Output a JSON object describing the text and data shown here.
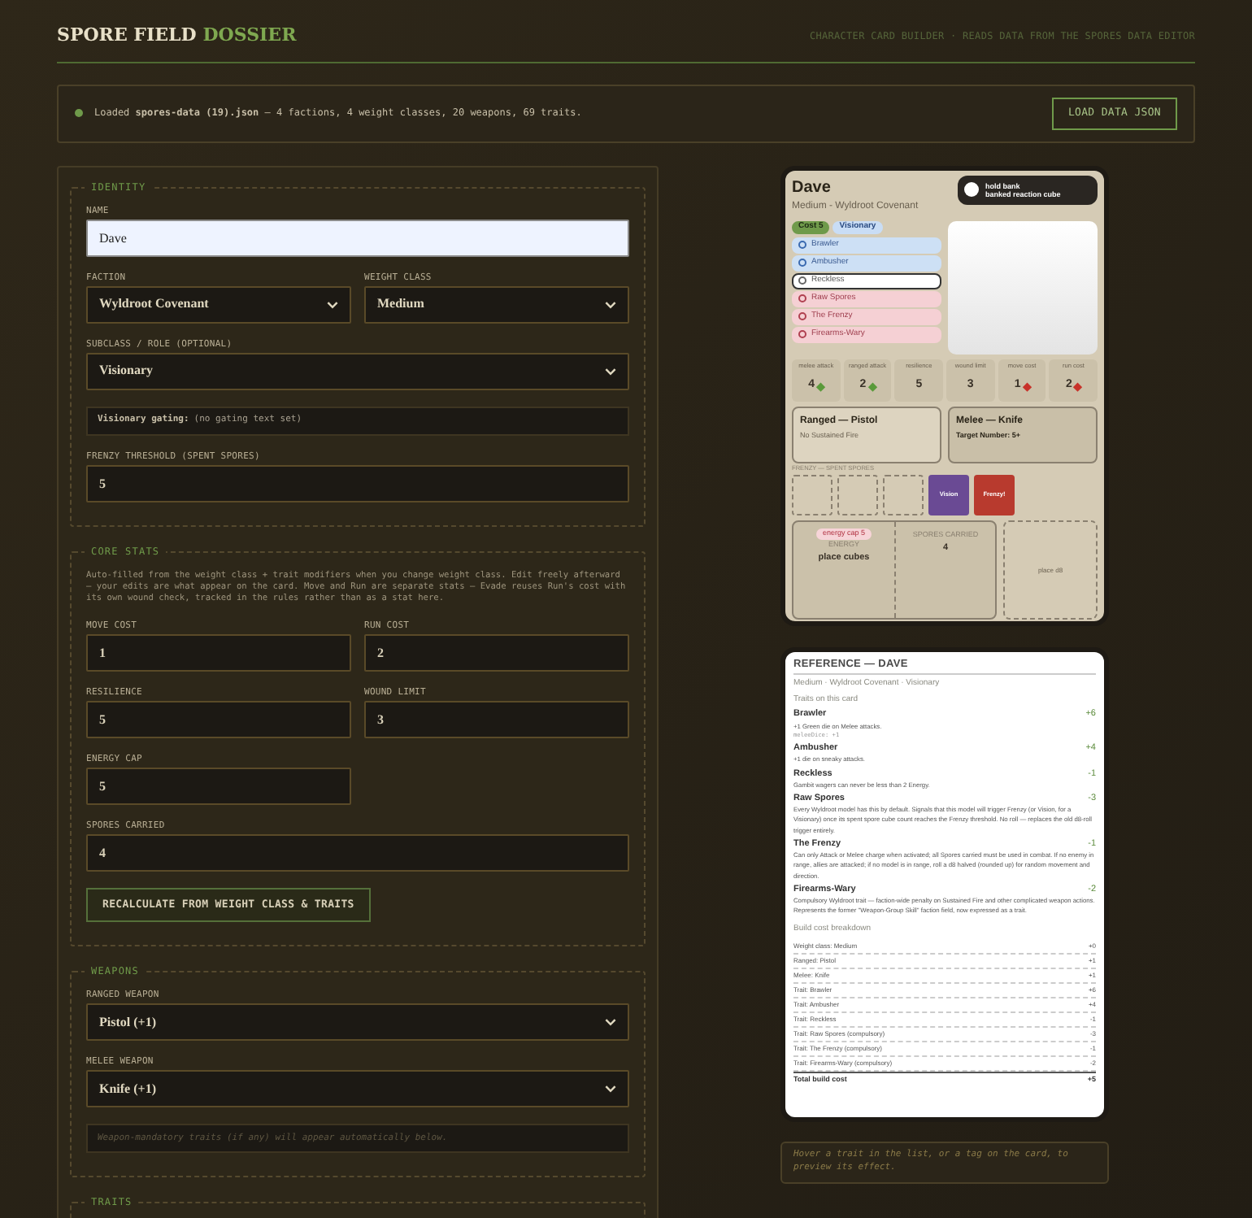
{
  "header": {
    "title": "SPORE FIELD",
    "title_accent": "DOSSIER",
    "tagline": "CHARACTER CARD BUILDER · READS DATA FROM THE SPORES DATA EDITOR"
  },
  "status": {
    "text": "Loaded **spores-data (19).json** — 4 factions, 4 weight classes, 20 weapons, 69 traits.",
    "button": "LOAD DATA JSON"
  },
  "sections": [
    {
      "legend": "IDENTITY",
      "rows": [
        [
          {
            "kind": "text",
            "label": "NAME",
            "value": "Dave"
          }
        ],
        [
          {
            "kind": "select",
            "label": "FACTION",
            "value": "Wyldroot Covenant"
          },
          {
            "kind": "select",
            "label": "WEIGHT CLASS",
            "value": "Medium"
          }
        ],
        [
          {
            "kind": "select",
            "label": "SUBCLASS / ROLE (OPTIONAL)",
            "value": "Visionary"
          }
        ],
        [
          {
            "kind": "note",
            "title": "Visionary gating:",
            "text": "(no gating text set)"
          }
        ],
        [
          {
            "kind": "number_wide",
            "label": "FRENZY THRESHOLD (SPENT SPORES)",
            "value": "5"
          }
        ]
      ]
    },
    {
      "legend": "CORE STATS",
      "rows": [
        [
          {
            "kind": "description",
            "text": "Auto-filled from the weight class + trait modifiers when you change weight class. Edit freely afterward — your edits are what appear on the card. Move and Run are separate stats — Evade reuses Run's cost with its own wound check, tracked in the rules rather than as a stat here."
          }
        ],
        [
          {
            "kind": "number",
            "label": "MOVE COST",
            "value": "1"
          },
          {
            "kind": "number",
            "label": "RUN COST",
            "value": "2"
          }
        ],
        [
          {
            "kind": "number",
            "label": "RESILIENCE",
            "value": "5"
          },
          {
            "kind": "number",
            "label": "WOUND LIMIT",
            "value": "3"
          }
        ],
        [
          {
            "kind": "number",
            "label": "ENERGY CAP",
            "value": "5"
          }
        ],
        [
          {
            "kind": "number_wide",
            "label": "SPORES CARRIED",
            "value": "4"
          }
        ],
        [
          {
            "kind": "button",
            "text": "RECALCULATE FROM WEIGHT CLASS & TRAITS"
          }
        ]
      ]
    },
    {
      "legend": "WEAPONS",
      "rows": [
        [
          {
            "kind": "select",
            "label": "RANGED WEAPON",
            "value": "Pistol (+1)"
          }
        ],
        [
          {
            "kind": "select",
            "label": "MELEE WEAPON",
            "value": "Knife (+1)"
          }
        ],
        [
          {
            "kind": "hint",
            "text": "Weapon-mandatory traits (if any) will appear automatically below."
          }
        ]
      ]
    },
    {
      "legend": "TRAITS"
    }
  ],
  "card": {
    "name": "Dave",
    "subtitle": "Medium - Wyldroot Covenant",
    "bank": {
      "title": "hold bank",
      "subtitle": "banked reaction cube"
    },
    "tags": [
      {
        "text": "Cost 5",
        "color": "#6f9a4a"
      },
      {
        "text": "Visionary",
        "color": "#c9ddf5"
      }
    ],
    "traits": [
      {
        "text": "Brawler",
        "kind": "positive"
      },
      {
        "text": "Ambusher",
        "kind": "positive"
      },
      {
        "text": "Reckless",
        "kind": "neutral"
      },
      {
        "text": "Raw Spores",
        "kind": "negative"
      },
      {
        "text": "The Frenzy",
        "kind": "negative"
      },
      {
        "text": "Firearms-Wary",
        "kind": "negative"
      }
    ],
    "stats": [
      {
        "label": "melee attack",
        "value": "4",
        "color": "#5a9a3a"
      },
      {
        "label": "ranged attack",
        "value": "2",
        "color": "#5a9a3a"
      },
      {
        "label": "resilience",
        "value": "5"
      },
      {
        "label": "wound limit",
        "value": "3"
      },
      {
        "label": "move cost",
        "value": "1",
        "color": "#c8322a"
      },
      {
        "label": "run cost",
        "value": "2",
        "color": "#c8322a"
      }
    ],
    "weapons": [
      {
        "title": "Ranged — Pistol",
        "detail": "No Sustained Fire"
      },
      {
        "title": "Melee — Knife",
        "detail": "Target Number: 5+"
      }
    ],
    "frenzy_label": "FRENZY — SPENT SPORES",
    "slots": [
      {
        "kind": "empty"
      },
      {
        "kind": "empty"
      },
      {
        "kind": "empty"
      },
      {
        "kind": "filled",
        "text": "Vision",
        "color": "#6a4a94"
      },
      {
        "kind": "filled",
        "text": "Frenzy!",
        "color": "#b83a2e"
      }
    ],
    "energy": {
      "cap": "energy cap 5",
      "label": "ENERGY",
      "hint": "place cubes"
    },
    "spores": {
      "label": "SPORES CARRIED",
      "value": "4"
    },
    "dice": "place d8"
  },
  "reference": {
    "title": "REFERENCE — DAVE",
    "subtitle": "Medium · Wyldroot Covenant · Visionary",
    "traits_heading": "Traits on this card",
    "traits": [
      {
        "name": "Brawler",
        "cost": "+6",
        "desc": "+1 Green die on Melee attacks.",
        "note": "meleeDice: +1"
      },
      {
        "name": "Ambusher",
        "cost": "+4",
        "desc": "+1 die on sneaky attacks."
      },
      {
        "name": "Reckless",
        "cost": "-1",
        "desc": "Gambit wagers can never be less than 2 Energy."
      },
      {
        "name": "Raw Spores",
        "cost": "-3",
        "desc": "Every Wyldroot model has this by default. Signals that this model will trigger Frenzy (or Vision, for a Visionary) once its spent spore cube count reaches the Frenzy threshold. No roll — replaces the old d8-roll trigger entirely."
      },
      {
        "name": "The Frenzy",
        "cost": "-1",
        "desc": "Can only Attack or Melee charge when activated; all Spores carried must be used in combat. If no enemy in range, allies are attacked; if no model is in range, roll a d8 halved (rounded up) for random movement and direction."
      },
      {
        "name": "Firearms-Wary",
        "cost": "-2",
        "desc": "Compulsory Wyldroot trait — faction-wide penalty on Sustained Fire and other complicated weapon actions. Represents the former \"Weapon-Group Skill\" faction field, now expressed as a trait."
      }
    ],
    "breakdown_heading": "Build cost breakdown",
    "breakdown": [
      {
        "label": "Weight class: Medium",
        "value": "+0"
      },
      {
        "label": "Ranged: Pistol",
        "value": "+1"
      },
      {
        "label": "Melee: Knife",
        "value": "+1"
      },
      {
        "label": "Trait: Brawler",
        "value": "+6"
      },
      {
        "label": "Trait: Ambusher",
        "value": "+4"
      },
      {
        "label": "Trait: Reckless",
        "value": "-1"
      },
      {
        "label": "Trait: Raw Spores (compulsory)",
        "value": "-3"
      },
      {
        "label": "Trait: The Frenzy (compulsory)",
        "value": "-1"
      },
      {
        "label": "Trait: Firearms-Wary (compulsory)",
        "value": "-2"
      }
    ],
    "total": {
      "label": "Total build cost",
      "value": "+5"
    }
  },
  "hover_hint": "Hover a trait in the list, or a tag on the card, to preview its effect."
}
